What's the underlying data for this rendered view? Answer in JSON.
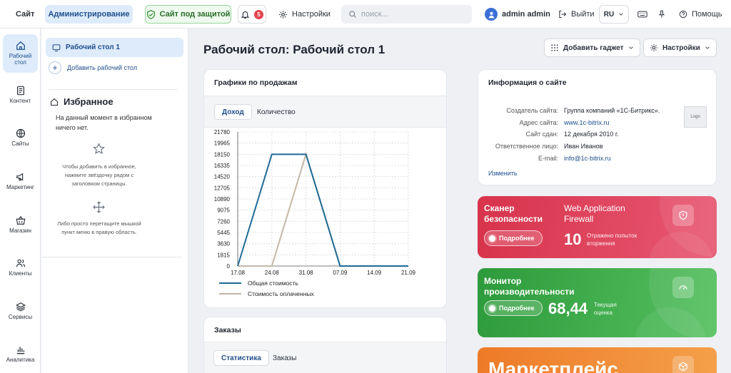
{
  "topbar": {
    "site_label": "Сайт",
    "admin_label": "Администрирование",
    "secure_label": "Сайт под защитой",
    "notifications_count": "5",
    "settings_label": "Настройки",
    "search_placeholder": "поиск...",
    "user_name": "admin admin",
    "logout_label": "Выйти",
    "language": "RU",
    "help_label": "Помощь"
  },
  "rail": {
    "desktop": "Рабочий стол",
    "content": "Контент",
    "sites": "Сайты",
    "marketing": "Маркетинг",
    "shop": "Магазин",
    "clients": "Клиенты",
    "services": "Сервисы",
    "analytics": "Аналитика"
  },
  "side": {
    "desktop_item": "Рабочий стол 1",
    "add_desktop": "Добавить рабочий стол",
    "favorites_title": "Избранное",
    "favorites_empty": "На данный момент в избранном ничего нет.",
    "hint_star": "Чтобы добавить в избранное, нажмите звёздочку рядом с заголовком страницы.",
    "hint_drag": "Либо просто перетащите мышкой пункт меню в правую область."
  },
  "main": {
    "title": "Рабочий стол: Рабочий стол 1",
    "add_gadget": "Добавить гаджет",
    "settings": "Настройки"
  },
  "sales": {
    "title": "Графики по продажам",
    "tab_income": "Доход",
    "tab_quantity": "Количество"
  },
  "chart_data": {
    "type": "line",
    "x": [
      "17.08",
      "24.08",
      "31.08",
      "07.09",
      "14.09",
      "21.09"
    ],
    "yticks": [
      0,
      1815,
      3630,
      5445,
      7260,
      9075,
      10890,
      12705,
      14520,
      16335,
      18150,
      19965,
      21780
    ],
    "ylim": [
      0,
      21780
    ],
    "grid": true,
    "legend_position": "bottom",
    "series": [
      {
        "name": "Общая стоимость",
        "color": "#1e6a96",
        "points": [
          [
            "17.08",
            0
          ],
          [
            "24.08",
            18150
          ],
          [
            "31.08",
            18150
          ],
          [
            "07.09",
            0
          ],
          [
            "21.09",
            0
          ]
        ]
      },
      {
        "name": "Стоимость оплаченных",
        "color": "#c4b8a6",
        "points": [
          [
            "17.08",
            0
          ],
          [
            "24.08",
            0
          ],
          [
            "31.08",
            18150
          ],
          [
            "07.09",
            0
          ],
          [
            "21.09",
            0
          ]
        ]
      }
    ]
  },
  "orders": {
    "title": "Заказы",
    "tab_stats": "Статистика",
    "tab_orders": "Заказы"
  },
  "siteinfo": {
    "title": "Информация о сайте",
    "rows": [
      {
        "key": "Создатель сайта:",
        "value": "Группа компаний «1С-Битрикс»."
      },
      {
        "key": "Адрес сайта:",
        "value": "www.1c-bitrix.ru"
      },
      {
        "key": "Сайт сдан:",
        "value": "12 декабря 2010 г."
      },
      {
        "key": "Ответственное лицо:",
        "value": "Иван Иванов"
      },
      {
        "key": "E-mail:",
        "value": "info@1c-bitrix.ru"
      }
    ],
    "logo_label": "Logo",
    "edit_link": "Изменить"
  },
  "scanner": {
    "title": "Сканер безопасности",
    "more": "Подробнее",
    "waf": "Web Application Firewall",
    "count": "10",
    "count_label": "Отражено попыток вторжения",
    "color": "#d7334b"
  },
  "monitor": {
    "title": "Монитор производительности",
    "more": "Подробнее",
    "score": "68,44",
    "score_label": "Текущая оценка",
    "color": "#2d9a3b"
  },
  "marketplace": {
    "title": "Маркетплейс",
    "color": "#ee7a27"
  }
}
